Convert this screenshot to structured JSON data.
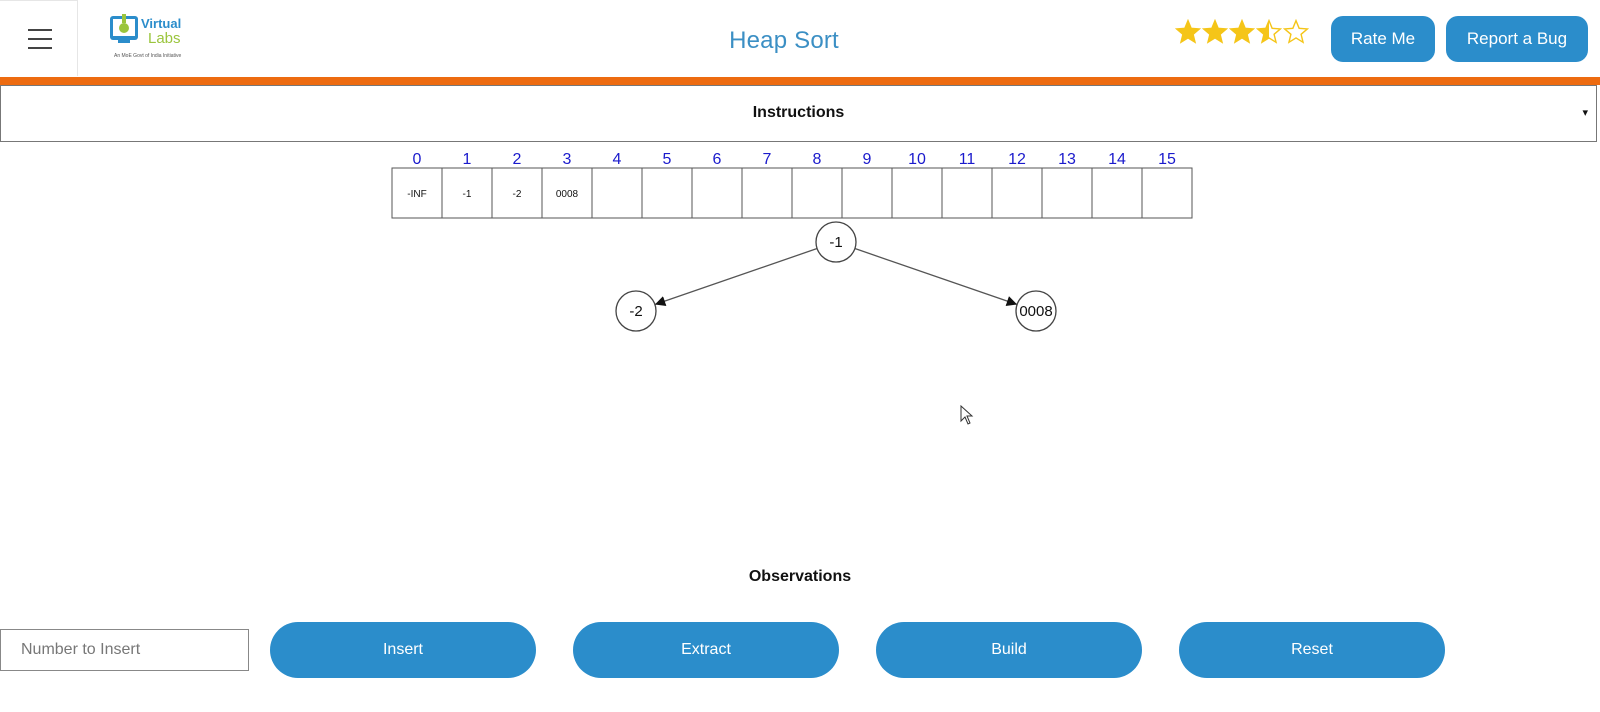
{
  "header": {
    "title": "Heap Sort",
    "rating": 3.5,
    "rating_max": 5,
    "rate_button": "Rate Me",
    "bug_button": "Report a Bug",
    "logo_text_1": "Virtual",
    "logo_text_2": "Labs",
    "logo_tagline": "An MoE Govt of India Initiative"
  },
  "colors": {
    "accent": "#2b8dcb",
    "title": "#3b8fc4",
    "orange_bar": "#ed6b10",
    "star": "#f5c518",
    "index_text": "#1a1acc"
  },
  "instructions": {
    "label": "Instructions",
    "caret": "▾"
  },
  "heap": {
    "indices": [
      "0",
      "1",
      "2",
      "3",
      "4",
      "5",
      "6",
      "7",
      "8",
      "9",
      "10",
      "11",
      "12",
      "13",
      "14",
      "15"
    ],
    "cells": [
      "-INF",
      "-1",
      "-2",
      "0008",
      "",
      "",
      "",
      "",
      "",
      "",
      "",
      "",
      "",
      "",
      "",
      ""
    ],
    "nodes": [
      {
        "label": "-1",
        "role": "root"
      },
      {
        "label": "-2",
        "role": "left-child"
      },
      {
        "label": "0008",
        "role": "right-child"
      }
    ]
  },
  "observations": {
    "label": "Observations"
  },
  "controls": {
    "input_placeholder": "Number to Insert",
    "input_value": "",
    "insert": "Insert",
    "extract": "Extract",
    "build": "Build",
    "reset": "Reset"
  }
}
